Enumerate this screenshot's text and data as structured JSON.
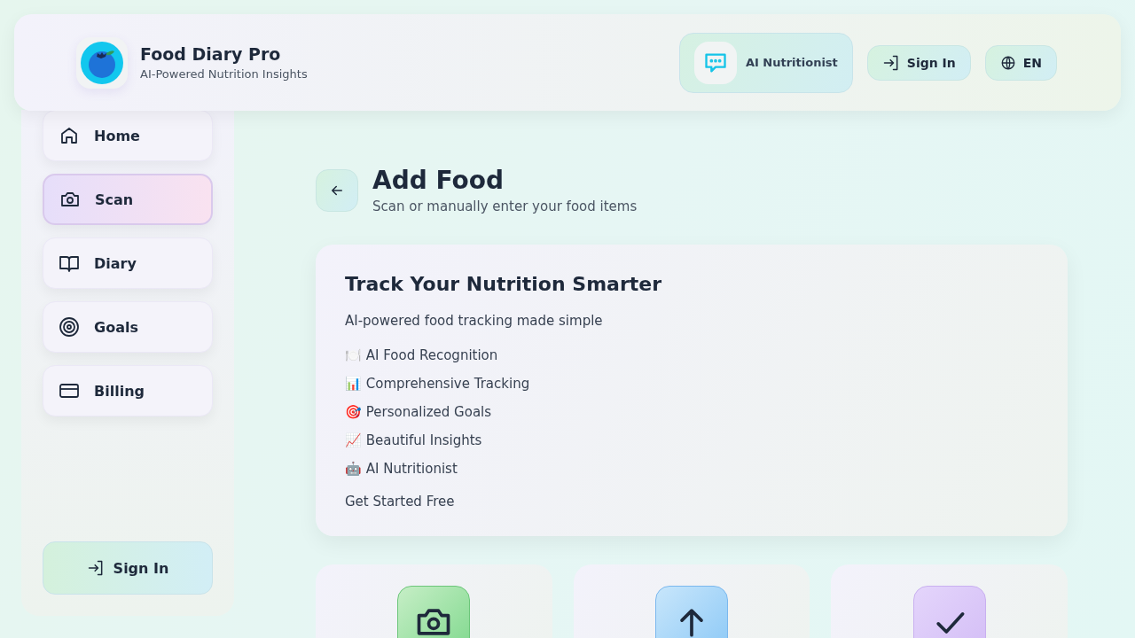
{
  "header": {
    "app_name": "Food Diary Pro",
    "tagline": "AI-Powered Nutrition Insights",
    "ai_button": "AI Nutritionist",
    "sign_in": "Sign In",
    "language": "EN"
  },
  "sidebar": {
    "items": [
      {
        "label": "Home",
        "kind": "home",
        "selected": false
      },
      {
        "label": "Scan",
        "kind": "camera",
        "selected": true
      },
      {
        "label": "Diary",
        "kind": "book",
        "selected": false
      },
      {
        "label": "Goals",
        "kind": "target",
        "selected": false
      },
      {
        "label": "Billing",
        "kind": "card",
        "selected": false
      }
    ],
    "sign_in": "Sign In"
  },
  "page": {
    "title": "Add Food",
    "subtitle": "Scan or manually enter your food items"
  },
  "promo": {
    "title": "Track Your Nutrition Smarter",
    "intro": "AI-powered food tracking made simple",
    "features": [
      "🍽️ AI Food Recognition",
      "📊 Comprehensive Tracking",
      "🎯 Personalized Goals",
      "📈 Beautiful Insights",
      "🤖 AI Nutritionist"
    ],
    "cta": "Get Started Free"
  },
  "options": [
    {
      "kind": "camera"
    },
    {
      "kind": "upload"
    },
    {
      "kind": "check"
    }
  ]
}
